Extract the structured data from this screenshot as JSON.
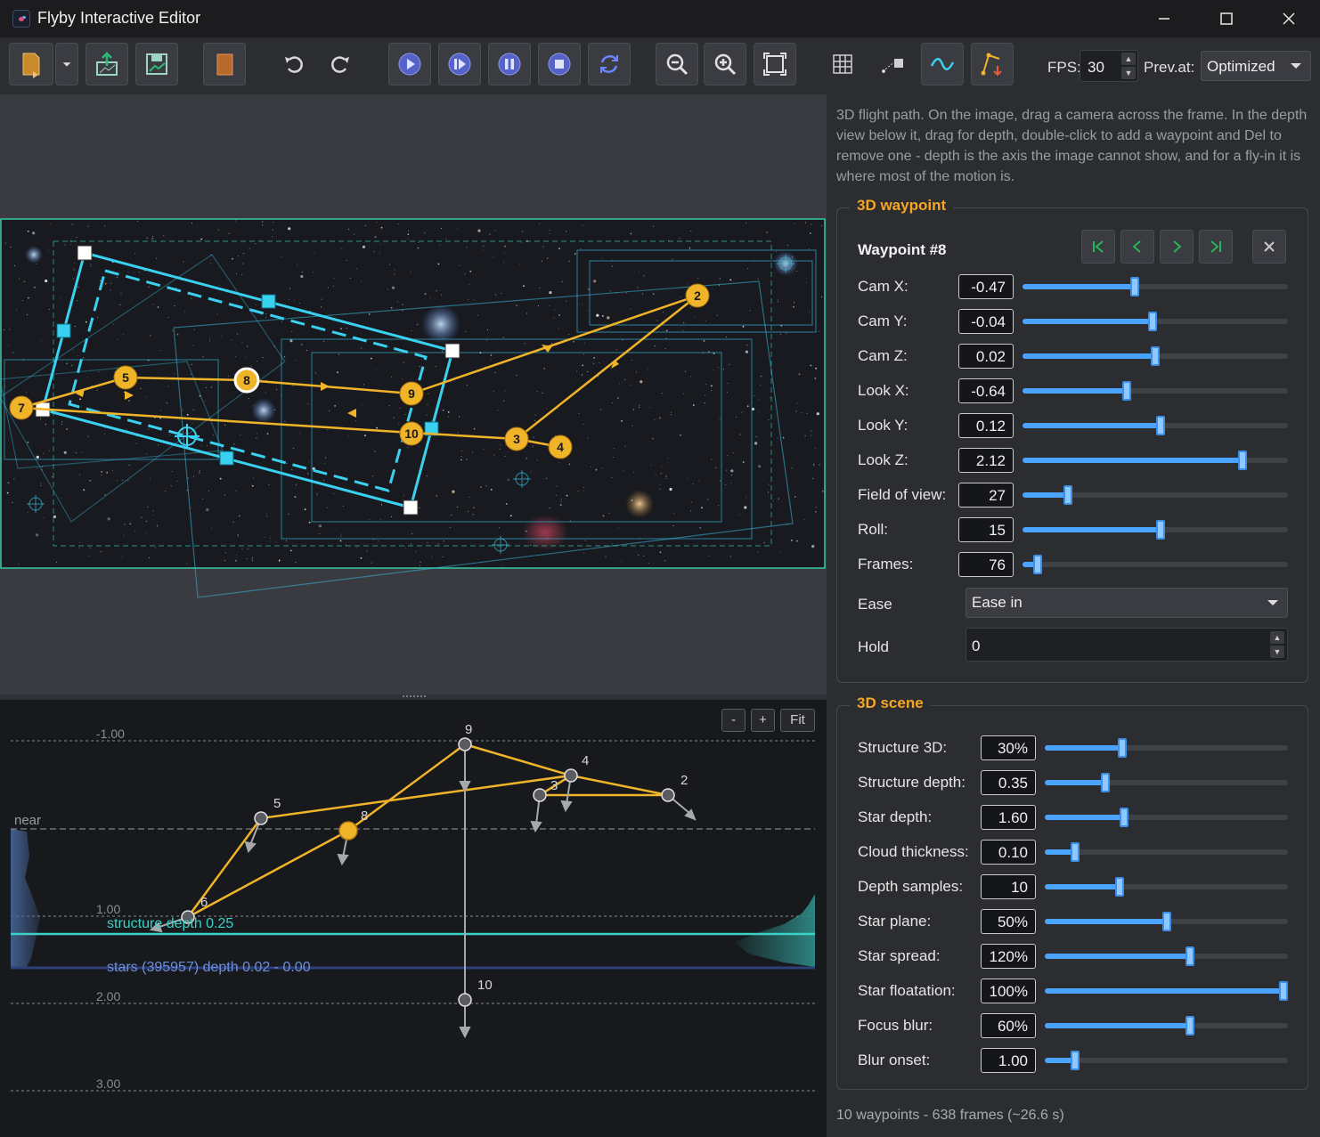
{
  "window": {
    "title": "Flyby Interactive Editor",
    "minimize_icon": "minimize-icon",
    "maximize_icon": "maximize-icon",
    "close_icon": "close-icon"
  },
  "toolbar": {
    "fps_label": "FPS:",
    "fps_value": "30",
    "preview_label": "Prev.at:",
    "preview_value": "Optimized",
    "buttons": [
      "new-file-icon",
      "dropdown-icon",
      "export-icon",
      "save-icon",
      "bookmark-icon",
      "undo-icon",
      "redo-icon",
      "play-icon",
      "play-step-icon",
      "pause-icon",
      "stop-icon",
      "loop-icon",
      "zoom-out-icon",
      "zoom-in-icon",
      "fit-icon",
      "grid-icon",
      "camera-path-icon",
      "smooth-curve-icon",
      "path-edit-icon"
    ]
  },
  "image_view": {
    "waypoint_labels": [
      "7",
      "5",
      "8",
      "9",
      "10",
      "3",
      "4",
      "2"
    ],
    "path_color": "#f0b429",
    "frame_color": "#3ad1f0"
  },
  "depth_view": {
    "buttons": {
      "minus": "-",
      "plus": "+",
      "fit": "Fit"
    },
    "axis_labels": [
      "-1.00",
      "1.00",
      "2.00",
      "3.00"
    ],
    "near_label": "near",
    "structure_label": "structure  depth 0.25",
    "stars_label": "stars (395957)  depth 0.02 - 0.00",
    "node_labels": [
      "9",
      "4",
      "3",
      "2",
      "5",
      "8",
      "6",
      "10"
    ]
  },
  "panel": {
    "description": "3D flight path. On the image, drag a camera across the frame. In the depth view below it, drag for depth, double-click to add a waypoint and Del to remove one - depth is the axis the image cannot show, and for a fly-in it is where most of the motion is.",
    "waypoint_group": {
      "title": "3D waypoint",
      "heading": "Waypoint #8",
      "nav_icons": [
        "first-waypoint-icon",
        "prev-waypoint-icon",
        "next-waypoint-icon",
        "last-waypoint-icon",
        "delete-waypoint-icon"
      ],
      "params": [
        {
          "label": "Cam X:",
          "value": "-0.47",
          "level": 0.42
        },
        {
          "label": "Cam Y:",
          "value": "-0.04",
          "level": 0.49
        },
        {
          "label": "Cam Z:",
          "value": "0.02",
          "level": 0.5
        },
        {
          "label": "Look X:",
          "value": "-0.64",
          "level": 0.39
        },
        {
          "label": "Look Y:",
          "value": "0.12",
          "level": 0.52
        },
        {
          "label": "Look Z:",
          "value": "2.12",
          "level": 0.84
        },
        {
          "label": "Field of view:",
          "value": "27",
          "level": 0.16
        },
        {
          "label": "Roll:",
          "value": "15",
          "level": 0.52
        },
        {
          "label": "Frames:",
          "value": "76",
          "level": 0.04
        }
      ],
      "ease_label": "Ease",
      "ease_value": "Ease in",
      "hold_label": "Hold",
      "hold_value": "0"
    },
    "scene_group": {
      "title": "3D scene",
      "params": [
        {
          "label": "Structure 3D:",
          "value": "30%",
          "level": 0.31
        },
        {
          "label": "Structure depth:",
          "value": "0.35",
          "level": 0.24
        },
        {
          "label": "Star depth:",
          "value": "1.60",
          "level": 0.32
        },
        {
          "label": "Cloud thickness:",
          "value": "0.10",
          "level": 0.11
        },
        {
          "label": "Depth samples:",
          "value": "10",
          "level": 0.3
        },
        {
          "label": "Star plane:",
          "value": "50%",
          "level": 0.5
        },
        {
          "label": "Star spread:",
          "value": "120%",
          "level": 0.6
        },
        {
          "label": "Star floatation:",
          "value": "100%",
          "level": 1.0
        },
        {
          "label": "Focus blur:",
          "value": "60%",
          "level": 0.6
        },
        {
          "label": "Blur onset:",
          "value": "1.00",
          "level": 0.11
        }
      ]
    },
    "status": "10 waypoints  -  638 frames  (~26.6 s)"
  }
}
